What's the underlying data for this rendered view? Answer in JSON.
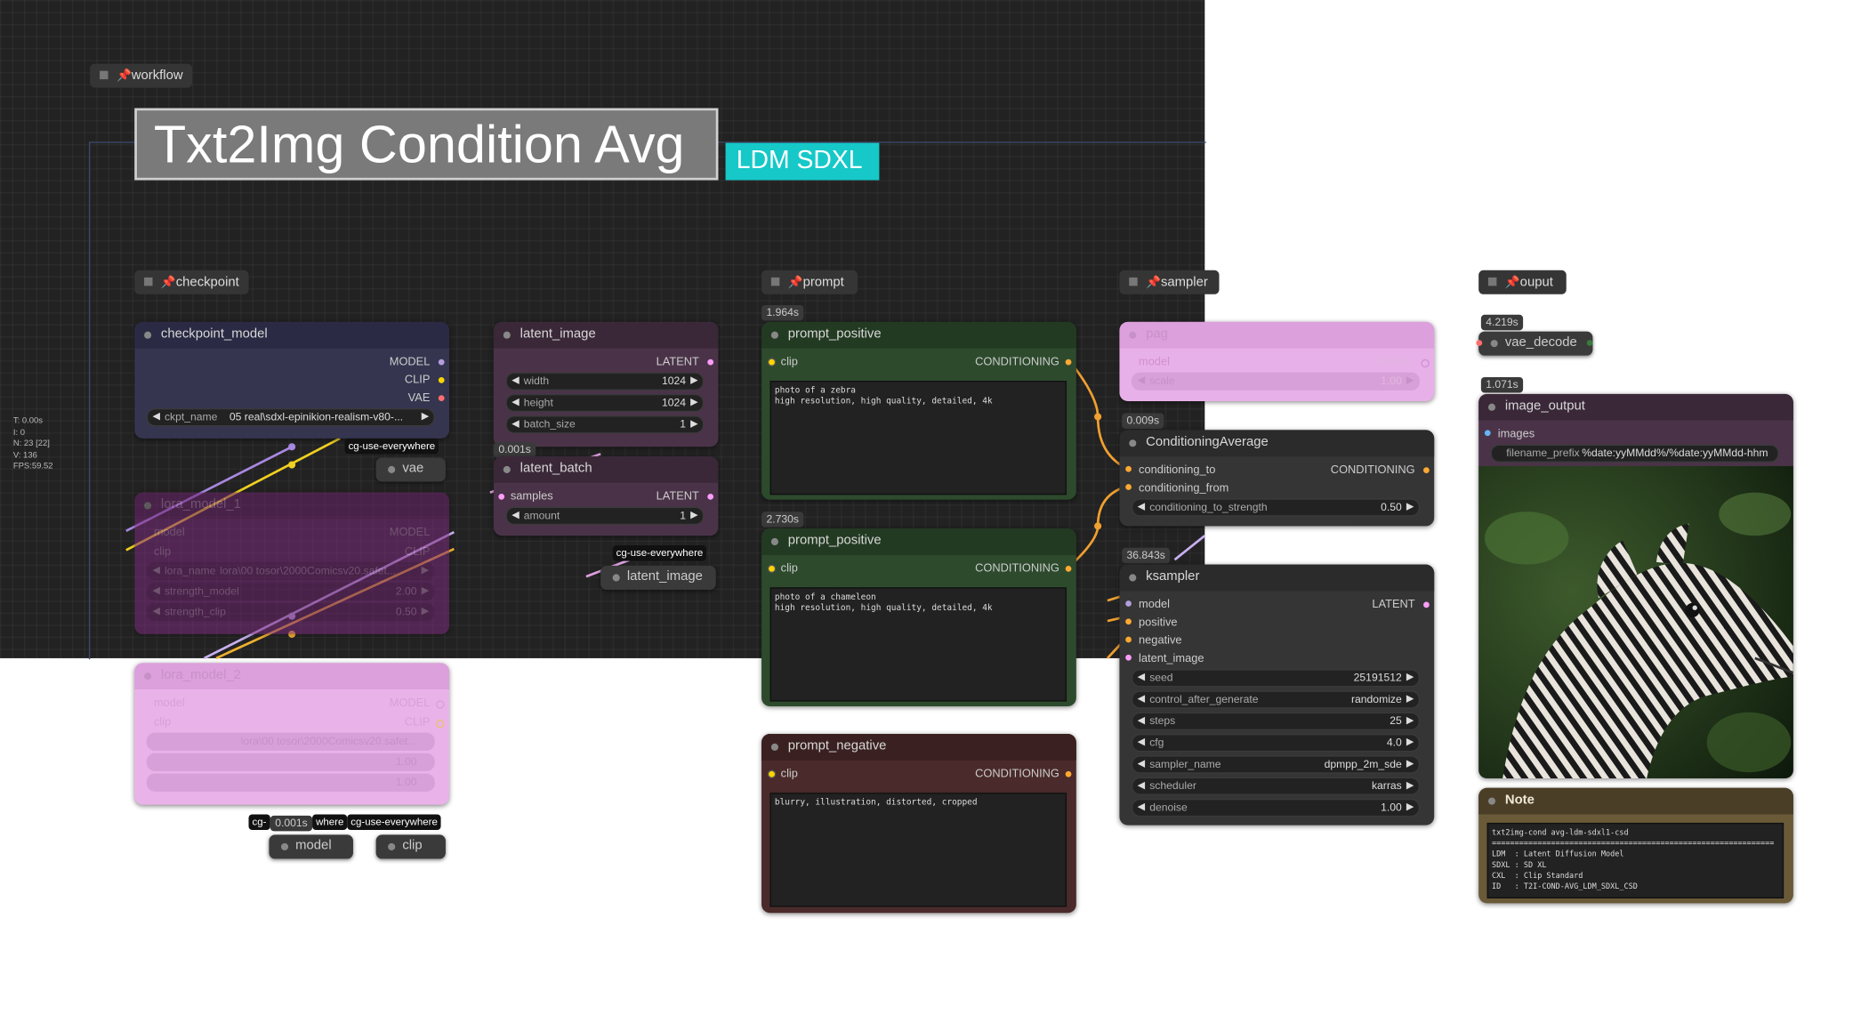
{
  "groups": {
    "workflow": "workflow",
    "checkpoint": "checkpoint",
    "prompt": "prompt",
    "sampler": "sampler",
    "output": "ouput"
  },
  "title_main": "Txt2Img Condition Avg",
  "title_sub": "LDM SDXL",
  "stats": "T: 0.00s\nI: 0\nN: 23 [22]\nV: 136\nFPS:59.52",
  "checkpoint_model": {
    "title": "checkpoint_model",
    "outputs": [
      "MODEL",
      "CLIP",
      "VAE"
    ],
    "ckpt_label": "ckpt_name",
    "ckpt_value": "05 real\\sdxl-epinikion-realism-v80-..."
  },
  "lora_model": {
    "title": "lora_model_1",
    "in_model": "model",
    "in_clip": "clip",
    "out_model": "MODEL",
    "out_clip": "CLIP",
    "lora_label": "lora_name",
    "lora_value": "lora\\00 tosor\\2000Comicsv20.safet...",
    "strength_model_label": "strength_model",
    "strength_model_value": "2.00",
    "strength_clip_label": "strength_clip",
    "strength_clip_value": "0.50"
  },
  "lora_model_2": {
    "title": "lora_model_2",
    "out_model": "MODEL",
    "out_clip": "CLIP",
    "w1": "lora\\00 tosor\\2000Comicsv20.safet...",
    "w2": "1.00",
    "w3": "1.00",
    "in_model": "model",
    "in_clip": "clip"
  },
  "latent_image": {
    "title": "latent_image",
    "output": "LATENT",
    "width_label": "width",
    "width_value": "1024",
    "height_label": "height",
    "height_value": "1024",
    "batch_label": "batch_size",
    "batch_value": "1"
  },
  "latent_batch": {
    "timing": "0.001s",
    "title": "latent_batch",
    "input": "samples",
    "output": "LATENT",
    "amount_label": "amount",
    "amount_value": "1"
  },
  "cg_tags": {
    "vae": "cg-use-everywhere",
    "latent": "cg-use-everywhere",
    "model_left": "cg-",
    "model_right": "where",
    "clip": "cg-use-everywhere"
  },
  "pills": {
    "vae": "vae",
    "latent_image": "latent_image",
    "model": "model",
    "clip": "clip",
    "vae_decode": "vae_decode"
  },
  "pill_timing": "0.001s",
  "prompt_positive_1": {
    "timing": "1.964s",
    "title": "prompt_positive",
    "input": "clip",
    "output": "CONDITIONING",
    "text": "photo of a zebra\nhigh resolution, high quality, detailed, 4k"
  },
  "prompt_positive_2": {
    "timing": "2.730s",
    "title": "prompt_positive",
    "input": "clip",
    "output": "CONDITIONING",
    "text": "photo of a chameleon\nhigh resolution, high quality, detailed, 4k"
  },
  "prompt_negative": {
    "title": "prompt_negative",
    "input": "clip",
    "output": "CONDITIONING",
    "text": "blurry, illustration, distorted, cropped"
  },
  "pag": {
    "title": "pag",
    "input": "model",
    "output": "MODEL",
    "scale_label": "scale",
    "scale_value": "1.00"
  },
  "conditioning_average": {
    "timing": "0.009s",
    "title": "ConditioningAverage",
    "in1": "conditioning_to",
    "in2": "conditioning_from",
    "output": "CONDITIONING",
    "strength_label": "conditioning_to_strength",
    "strength_value": "0.50"
  },
  "ksampler": {
    "timing": "36.843s",
    "title": "ksampler",
    "inputs": [
      "model",
      "positive",
      "negative",
      "latent_image"
    ],
    "output": "LATENT",
    "widgets": [
      {
        "label": "seed",
        "value": "25191512"
      },
      {
        "label": "control_after_generate",
        "value": "randomize"
      },
      {
        "label": "steps",
        "value": "25"
      },
      {
        "label": "cfg",
        "value": "4.0"
      },
      {
        "label": "sampler_name",
        "value": "dpmpp_2m_sde"
      },
      {
        "label": "scheduler",
        "value": "karras"
      },
      {
        "label": "denoise",
        "value": "1.00"
      }
    ]
  },
  "vae_decode": {
    "timing": "4.219s"
  },
  "image_output": {
    "timing": "1.071s",
    "title": "image_output",
    "input": "images",
    "prefix_label": "filename_prefix",
    "prefix_value": "%date:yyMMdd%/%date:yyMMdd-hhm"
  },
  "note": {
    "title": "Note",
    "text": "txt2img-cond avg-ldm-sdxl1-csd\n==============================================================\nLDM  : Latent Diffusion Model\nSDXL : SD XL\nCXL  : Clip Standard\nID   : T2I-COND-AVG_LDM_SDXL_CSD"
  },
  "colors": {
    "checkpoint_body": "#353550",
    "lora_body": "#5a2a5a",
    "latent_body": "#4a3348",
    "prompt_pos_body": "#2d4a2d",
    "prompt_neg_body": "#4a2a2a",
    "sampler_body": "#353535",
    "pag_body": "#e8b0e8",
    "title_cyan": "#16c8c8"
  }
}
